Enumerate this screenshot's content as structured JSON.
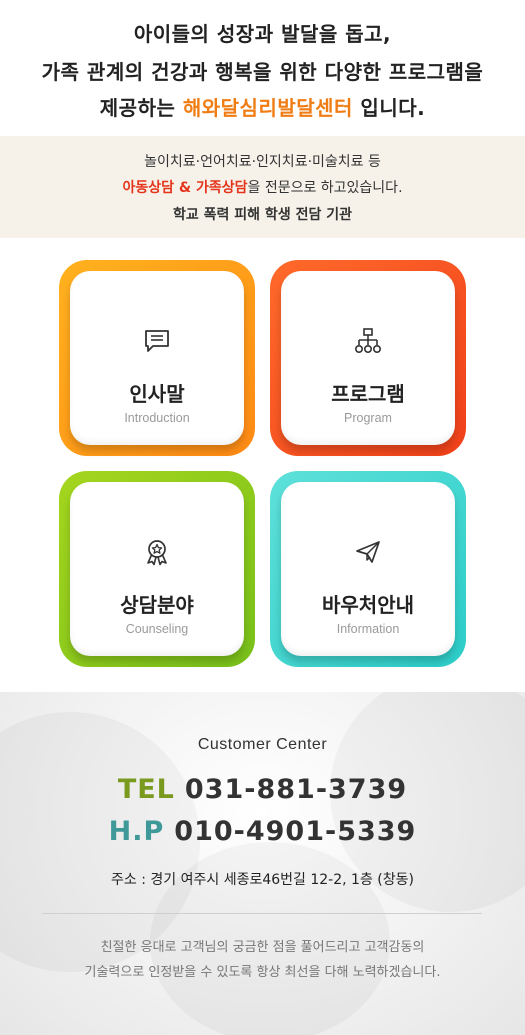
{
  "hero": {
    "line1": "아이들의 성장과 발달을 돕고,",
    "line2": "가족 관계의 건강과 행복을 위한 다양한 프로그램을",
    "line3_before": "제공하는",
    "line3_brand": "해와달심리발달센터",
    "line3_after": "입니다."
  },
  "band": {
    "line1": "놀이치료·언어치료·인지치료·미술치료 등",
    "line2_highlight": "아동상담 & 가족상담",
    "line2_rest": "을 전문으로 하고있습니다.",
    "line3": "학교 폭력 피해 학생 전담 기관"
  },
  "cards": [
    {
      "title": "인사말",
      "subtitle": "Introduction",
      "icon": "chat-icon",
      "color": "#ff9e18"
    },
    {
      "title": "프로그램",
      "subtitle": "Program",
      "icon": "sitemap-icon",
      "color": "#f4521f"
    },
    {
      "title": "상담분야",
      "subtitle": "Counseling",
      "icon": "award-icon",
      "color": "#8cc91c"
    },
    {
      "title": "바우처안내",
      "subtitle": "Information",
      "icon": "paper-plane-icon",
      "color": "#3fd6d0"
    }
  ],
  "contact": {
    "title": "Customer Center",
    "tel_label": "TEL",
    "tel": "031-881-3739",
    "hp_label": "H.P",
    "hp": "010-4901-5339",
    "address": "주소 : 경기 여주시 세종로46번길 12-2, 1층 (창동)",
    "note1": "친절한 응대로 고객님의 궁금한 점을 풀어드리고 고객감동의",
    "note2": "기술력으로 인정받을 수 있도록 항상 최선을 다해 노력하겠습니다."
  },
  "colors": {
    "brand": "#f07d14",
    "highlight": "#e5341b",
    "tel_label": "#7a9a1f",
    "hp_label": "#3f9999",
    "band_bg": "#f6f2ea"
  }
}
